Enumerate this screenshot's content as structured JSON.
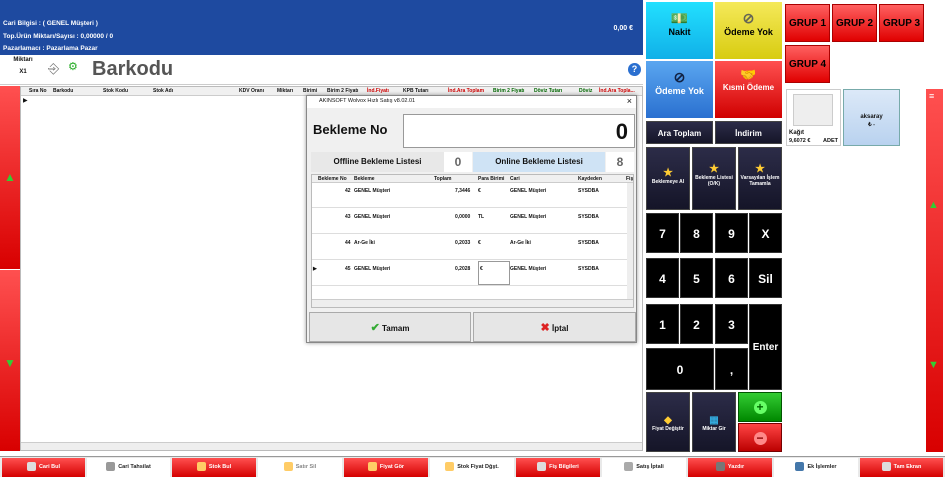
{
  "header": {
    "line1": "Cari Bilgisi : ( GENEL Müşteri )",
    "line2": "Top.Ürün Miktarı/Sayısı : 0,00000 / 0",
    "line3": "Pazarlamacı : Pazarlama Pazar",
    "total": "0,00 €"
  },
  "barcode": {
    "miktar_label": "Miktarı",
    "miktar_value": "X1",
    "title": "Barkodu",
    "help": "?"
  },
  "grid": {
    "columns": [
      "Sıra No",
      "Barkodu",
      "Stok Kodu",
      "Stok Adı",
      "KDV Oranı",
      "Miktarı",
      "Birimi",
      "Birim 2 Fiyatı",
      "İnd.Fiyatı",
      "KPB Tutarı",
      "İnd.Ara Toplam",
      "Birim 2 Fiyatı",
      "Döviz Tutarı",
      "Döviz",
      "İnd.Ara Topla..."
    ]
  },
  "dialog": {
    "title": "AKINSOFT Wolvox Hızlı Satış v8.02.01",
    "close": "×",
    "bekleme_no_label": "Bekleme No",
    "bekleme_no_value": "0",
    "offline_label": "Offline Bekleme Listesi",
    "offline_count": "0",
    "online_label": "Online Bekleme Listesi",
    "online_count": "8",
    "columns": [
      "Bekleme No",
      "Bekleme",
      "Toplam",
      "Para Birimi",
      "Cari",
      "Kaydeden",
      "Fiş"
    ],
    "rows": [
      {
        "no": "42",
        "name": "GENEL Müşteri",
        "total": "7,3446",
        "cur": "€",
        "cari": "GENEL Müşteri",
        "by": "SYSDBA"
      },
      {
        "no": "43",
        "name": "GENEL Müşteri",
        "total": "0,0000",
        "cur": "TL",
        "cari": "GENEL Müşteri",
        "by": "SYSDBA"
      },
      {
        "no": "44",
        "name": "Ar-Ge İki",
        "total": "0,2033",
        "cur": "€",
        "cari": "Ar-Ge İki",
        "by": "SYSDBA"
      },
      {
        "no": "45",
        "name": "GENEL Müşteri",
        "total": "0,2028",
        "cur": "€",
        "cari": "GENEL Müşteri",
        "by": "SYSDBA"
      }
    ],
    "ok": "Tamam",
    "cancel": "İptal"
  },
  "pay": {
    "nakit": "Nakit",
    "odeme_yok_top": "Ödeme Yok",
    "odeme_yok": "Ödeme Yok",
    "kismi": "Kısmi Ödeme",
    "ara_toplam": "Ara Toplam",
    "indirim": "İndirim",
    "bekleme_al": "Beklemeye Al",
    "bekleme_listesi": "Bekleme Listesi (O/K)",
    "varsayilan": "Varsayılan İşlem Tamamla",
    "fiyat_degistir": "Fiyat Değiştir",
    "miktar_gir": "Miktar Gir"
  },
  "keys": [
    "7",
    "8",
    "9",
    "X",
    "4",
    "5",
    "6",
    "Sil",
    "1",
    "2",
    "3",
    "Enter",
    "0",
    ","
  ],
  "groups": [
    "GRUP 1",
    "GRUP 2",
    "GRUP 3",
    "GRUP 4"
  ],
  "products": [
    {
      "name": "Kağıt",
      "price": "9,6072 €",
      "unit": "ADET"
    },
    {
      "name": "aksaray",
      "price": "₺ -"
    }
  ],
  "bottom": [
    "Cari Bul",
    "Cari Tahsilat",
    "Stok Bul",
    "Satır Sil",
    "Fiyat Gör",
    "Stok Fiyat Dğşt.",
    "Fiş Bilgileri",
    "Satış İptali",
    "Yazdır",
    "Ek İşlemler",
    "Tam Ekran"
  ]
}
